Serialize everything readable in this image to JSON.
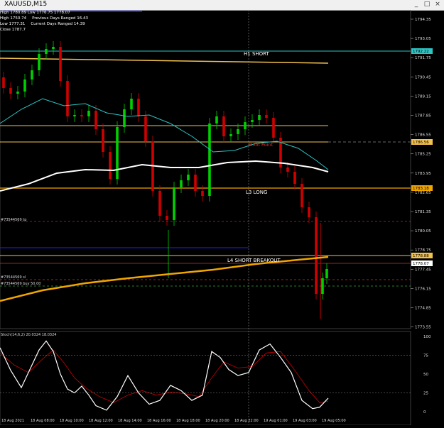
{
  "window": {
    "title": "XAUUSD,M15",
    "buttons": [
      "_",
      "□",
      "×"
    ]
  },
  "info_panel": {
    "rows": [
      [
        "High 1780.89",
        "Low 1776.75",
        "1778.07"
      ],
      [
        "High 1750.74",
        "Previous Days Ranged 16.43"
      ],
      [
        "Low 1777.31",
        "Current Days Ranged 14.39"
      ],
      [
        "Close 1787.7"
      ]
    ]
  },
  "labels": {
    "h1": "H1 SHORT",
    "pivot": "Pivot Point",
    "l3": "L3 LONG",
    "l4": "L4 SHORT BREAKOUT",
    "order_tp": "#73544569 tp",
    "order_sl": "#73544569 sl",
    "order_buy": "#73544569 buy 50.00",
    "stoch": "Stoch(14,6,2) 20.0324 18.0324"
  },
  "price_axis": {
    "ticks": [
      "1794.35",
      "1793.05",
      "1791.75",
      "1790.45",
      "1789.15",
      "1787.85",
      "1786.55",
      "1785.25",
      "1783.95",
      "1782.65",
      "1781.35",
      "1780.05",
      "1778.75",
      "1777.45",
      "1776.15",
      "1774.85",
      "1773.55"
    ],
    "tags": [
      {
        "label": "1792.22",
        "color": "#2ec4c4"
      },
      {
        "label": "1786.56",
        "color": "#f2c14e"
      },
      {
        "label": "1783.18",
        "color": "#f0a500"
      },
      {
        "label": "1778.88",
        "color": "#f2c14e"
      },
      {
        "label": "1778.07",
        "color": "#ffffff"
      }
    ]
  },
  "stoch_axis": {
    "ticks": [
      "100",
      "75",
      "50",
      "25",
      "0"
    ]
  },
  "time_axis": {
    "ticks": [
      "18 Aug 2021",
      "18 Aug 08:00",
      "18 Aug 10:00",
      "18 Aug 12:00",
      "18 Aug 14:00",
      "18 Aug 16:00",
      "18 Aug 18:00",
      "18 Aug 20:00",
      "18 Aug 22:00",
      "19 Aug 01:00",
      "19 Aug 03:00",
      "19 Aug 05:00"
    ]
  },
  "colors": {
    "bull": "#00d000",
    "bear": "#d00000",
    "cyan": "#2ec4c4",
    "yellow": "#f2c14e",
    "orange": "#f0a500",
    "white": "#ffffff",
    "navy": "#1b1bd0"
  }
}
